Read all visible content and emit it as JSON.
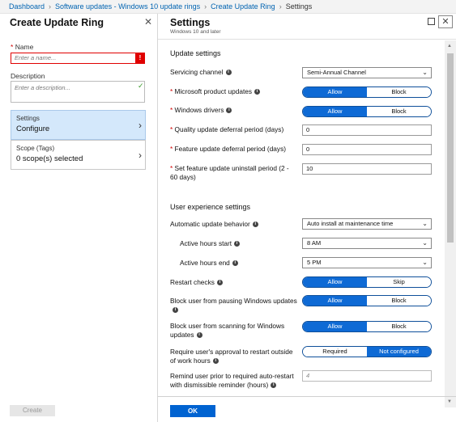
{
  "breadcrumb": {
    "items": [
      "Dashboard",
      "Software updates - Windows 10 update rings",
      "Create Update Ring",
      "Settings"
    ]
  },
  "left_blade": {
    "title": "Create Update Ring",
    "name_label": "Name",
    "name_required_marker": "*",
    "name_placeholder": "Enter a name...",
    "name_error_icon": "!",
    "description_label": "Description",
    "description_placeholder": "Enter a description...",
    "nav": [
      {
        "label": "Settings",
        "value": "Configure",
        "active": true
      },
      {
        "label": "Scope (Tags)",
        "value": "0 scope(s) selected",
        "active": false
      }
    ],
    "create_label": "Create"
  },
  "right_blade": {
    "title": "Settings",
    "subtitle": "Windows 10 and later",
    "update_settings_heading": "Update settings",
    "ux_settings_heading": "User experience settings",
    "servicing_channel": {
      "label": "Servicing channel",
      "value": "Semi-Annual Channel"
    },
    "ms_product_updates": {
      "label": "Microsoft product updates",
      "required": true,
      "options": [
        "Allow",
        "Block"
      ],
      "selected": "Allow"
    },
    "windows_drivers": {
      "label": "Windows drivers",
      "required": true,
      "options": [
        "Allow",
        "Block"
      ],
      "selected": "Allow"
    },
    "quality_deferral": {
      "label": "Quality update deferral period (days)",
      "required": true,
      "value": "0"
    },
    "feature_deferral": {
      "label": "Feature update deferral period (days)",
      "required": true,
      "value": "0"
    },
    "feature_uninstall": {
      "label": "Set feature update uninstall period (2 - 60 days)",
      "required": true,
      "value": "10"
    },
    "auto_update_behavior": {
      "label": "Automatic update behavior",
      "value": "Auto install at maintenance time"
    },
    "active_hours_start": {
      "label": "Active hours start",
      "value": "8 AM"
    },
    "active_hours_end": {
      "label": "Active hours end",
      "value": "5 PM"
    },
    "restart_checks": {
      "label": "Restart checks",
      "options": [
        "Allow",
        "Skip"
      ],
      "selected": "Allow"
    },
    "block_pausing": {
      "label": "Block user from pausing Windows updates",
      "options": [
        "Allow",
        "Block"
      ],
      "selected": "Allow"
    },
    "block_scanning": {
      "label": "Block user from scanning for Windows updates",
      "options": [
        "Allow",
        "Block"
      ],
      "selected": "Allow"
    },
    "require_approval": {
      "label": "Require user's approval to restart outside of work hours",
      "options": [
        "Required",
        "Not configured"
      ],
      "selected": "Not configured"
    },
    "remind_dismissible": {
      "label": "Remind user prior to required auto-restart with dismissible reminder (hours)",
      "placeholder": "4"
    },
    "ok_label": "OK"
  },
  "icons": {
    "required_marker": "*",
    "info": "i",
    "chevron_right": "›",
    "chevron_down": "⌄",
    "close": "✕",
    "check": "✓",
    "scroll_up": "▲",
    "scroll_down": "▼"
  },
  "colors": {
    "accent": "#0063d1",
    "toggle_on": "#0e6ad5",
    "error": "#e00000",
    "link": "#0063b1",
    "active_nav": "#d4e8fb"
  }
}
